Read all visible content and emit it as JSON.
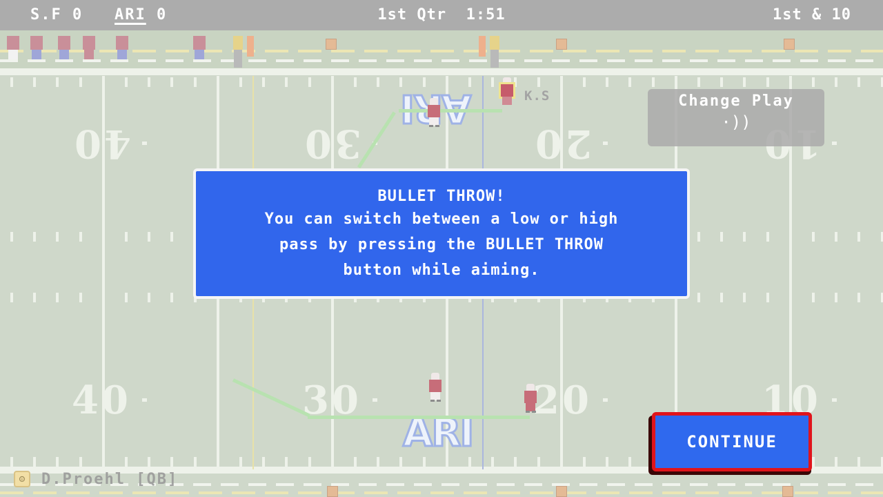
{
  "scoreboard": {
    "away_team": "S.F",
    "away_score": "0",
    "home_team": "ARI",
    "home_score": "0",
    "possession": "ARI",
    "quarter": "1st Qtr",
    "clock": "1:51",
    "down_distance": "1st & 10"
  },
  "field": {
    "yard_numbers_top": [
      "40",
      "30",
      "20",
      "10"
    ],
    "yard_numbers_bottom": [
      "40",
      "30",
      "20",
      "10"
    ],
    "end_zone_logo_top": "ARI",
    "end_zone_logo_bottom": "ARI",
    "receiver_label": "K.S",
    "colors": {
      "turf": "#cfd8ca",
      "line": "#eef2ea",
      "route": "#b8e2b0",
      "line_of_scrimmage": "#aab6de",
      "first_down": "#e8e2a8",
      "team_jersey": "#c76d79"
    }
  },
  "change_play": {
    "label": "Change Play",
    "icon": "signal-waves-icon",
    "icon_glyph": "·))"
  },
  "tutorial": {
    "title": "BULLET THROW!",
    "message": "You can switch between a low or high\npass by pressing the BULLET THROW\nbutton while aiming.",
    "bg_color": "#3166ec"
  },
  "continue_button": {
    "label": "CONTINUE",
    "bg_color": "#2f69ee",
    "border_color": "#e0141b"
  },
  "active_player": {
    "name": "D.Proehl [QB]",
    "avatar_icon": "smiley-face-icon",
    "avatar_glyph": "☺"
  }
}
